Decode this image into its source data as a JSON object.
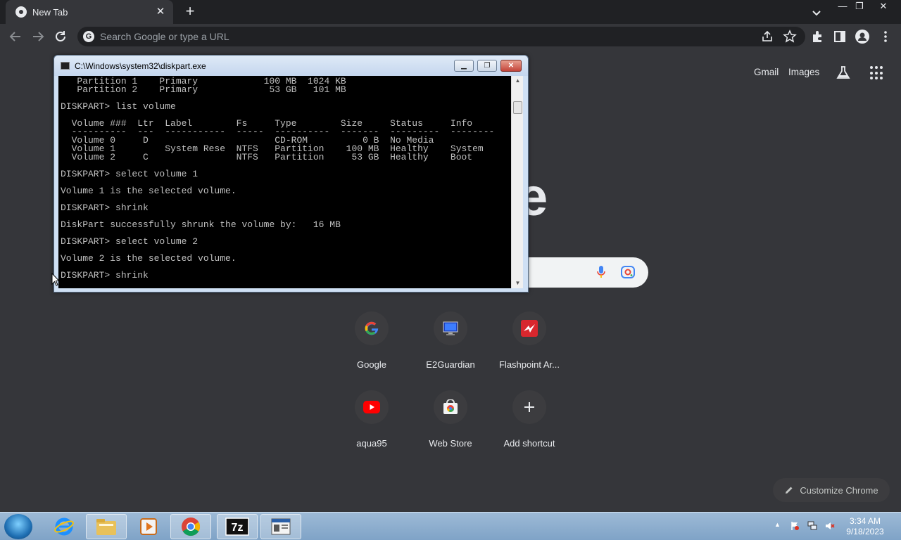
{
  "browser": {
    "tab_title": "New Tab",
    "omnibox_placeholder": "Search Google or type a URL",
    "window_controls": {
      "minimize": "—",
      "restore": "❐",
      "close": "✕"
    }
  },
  "ntp": {
    "gmail_link": "Gmail",
    "images_link": "Images",
    "logo_fragment": "e",
    "shortcuts": [
      {
        "label": "Google",
        "icon": "google-icon"
      },
      {
        "label": "E2Guardian",
        "icon": "monitor-icon"
      },
      {
        "label": "Flashpoint Ar...",
        "icon": "flashpoint-icon"
      },
      {
        "label": "aqua95",
        "icon": "youtube-icon"
      },
      {
        "label": "Web Store",
        "icon": "web-store-icon"
      },
      {
        "label": "Add shortcut",
        "icon": "plus-icon"
      }
    ],
    "customize_label": "Customize Chrome"
  },
  "cmd_window": {
    "title": "C:\\Windows\\system32\\diskpart.exe",
    "lines": [
      "   Partition 1    Primary            100 MB  1024 KB",
      "   Partition 2    Primary             53 GB   101 MB",
      "",
      "DISKPART> list volume",
      "",
      "  Volume ###  Ltr  Label        Fs     Type        Size     Status     Info",
      "  ----------  ---  -----------  -----  ----------  -------  ---------  --------",
      "  Volume 0     D                       CD-ROM          0 B  No Media",
      "  Volume 1         System Rese  NTFS   Partition    100 MB  Healthy    System",
      "  Volume 2     C                NTFS   Partition     53 GB  Healthy    Boot",
      "",
      "DISKPART> select volume 1",
      "",
      "Volume 1 is the selected volume.",
      "",
      "DISKPART> shrink",
      "",
      "DiskPart successfully shrunk the volume by:   16 MB",
      "",
      "DISKPART> select volume 2",
      "",
      "Volume 2 is the selected volume.",
      "",
      "DISKPART> shrink"
    ]
  },
  "taskbar": {
    "apps": [
      "internet-explorer-icon",
      "file-explorer-icon",
      "media-player-icon",
      "chrome-icon",
      "7zip-icon",
      "diskpart-icon"
    ],
    "clock_time": "3:34 AM",
    "clock_date": "9/18/2023"
  },
  "colors": {
    "page_bg": "#35363a",
    "tabstrip_bg": "#202124",
    "text": "#e8eaed"
  }
}
